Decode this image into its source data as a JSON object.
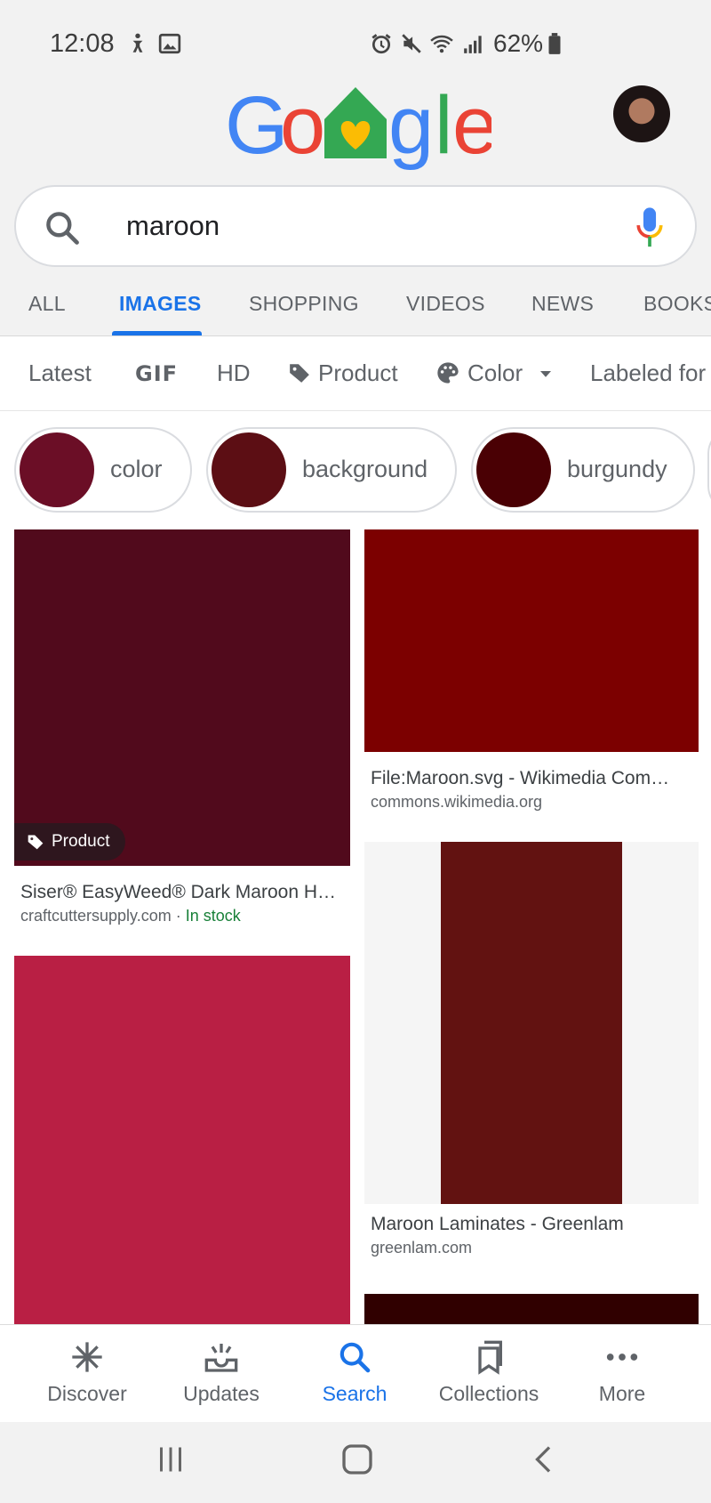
{
  "status_bar": {
    "time": "12:08",
    "battery": "62%",
    "icons": [
      "accessibility-icon",
      "image-icon",
      "alarm-icon",
      "mute-icon",
      "wifi-icon",
      "signal-icon",
      "battery-icon"
    ]
  },
  "header": {
    "logo": "Google",
    "colors": {
      "blue": "#4285f4",
      "red": "#ea4335",
      "yellow": "#fbbc04",
      "green": "#34a853"
    }
  },
  "search": {
    "query": "maroon",
    "accent": "#1a73e8"
  },
  "tabs": [
    {
      "label": "ALL"
    },
    {
      "label": "IMAGES",
      "active": true
    },
    {
      "label": "SHOPPING"
    },
    {
      "label": "VIDEOS"
    },
    {
      "label": "NEWS"
    },
    {
      "label": "BOOKS"
    }
  ],
  "filters": [
    {
      "label": "Latest"
    },
    {
      "label": "GIF"
    },
    {
      "label": "HD"
    },
    {
      "label": "Product",
      "icon": "tag-icon"
    },
    {
      "label": "Color",
      "icon": "palette-icon"
    },
    {
      "label": "Labeled for reuse"
    }
  ],
  "related": [
    {
      "label": "color",
      "swatch": "#6b0e26"
    },
    {
      "label": "background",
      "swatch": "#5c0e14"
    },
    {
      "label": "burgundy",
      "swatch": "#4a0004"
    }
  ],
  "results": [
    {
      "color": "#510a1c",
      "badge": "Product",
      "title": "Siser® EasyWeed® Dark Maroon H…",
      "source": "craftcuttersupply.com",
      "stock": "In stock"
    },
    {
      "color": "#7c0000",
      "title": "File:Maroon.svg - Wikimedia Com…",
      "source": "commons.wikimedia.org"
    },
    {
      "color": "#b91f44"
    },
    {
      "color": "#621211",
      "bg": "#f5f5f5",
      "title": "Maroon Laminates - Greenlam",
      "source": "greenlam.com"
    },
    {
      "color": "#300000"
    }
  ],
  "bottom_nav": [
    {
      "label": "Discover",
      "icon": "asterisk-icon"
    },
    {
      "label": "Updates",
      "icon": "inbox-icon"
    },
    {
      "label": "Search",
      "icon": "search-icon",
      "active": true
    },
    {
      "label": "Collections",
      "icon": "bookmarks-icon"
    },
    {
      "label": "More",
      "icon": "more-icon"
    }
  ]
}
